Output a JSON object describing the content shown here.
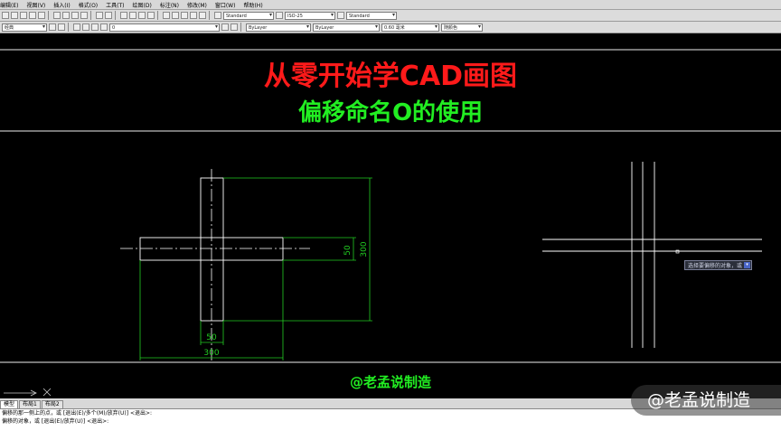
{
  "menubar": {
    "items": [
      "编辑(E)",
      "视图(V)",
      "插入(I)",
      "格式(O)",
      "工具(T)",
      "绘图(D)",
      "标注(N)",
      "修改(M)",
      "窗口(W)",
      "帮助(H)"
    ]
  },
  "toolbar": {
    "text_style": "Standard",
    "dim_style": "ISO-25",
    "table_style": "Standard",
    "workspace": "经典",
    "layer": "0",
    "color": "ByLayer",
    "linetype": "ByLayer",
    "lineweight": "0.60 毫米",
    "plot_style": "随颜色"
  },
  "overlay": {
    "title": "从零开始学CAD画图",
    "subtitle": "偏移命名O的使用",
    "watermark_center": "@老孟说制造",
    "watermark_corner": "@老孟说制造"
  },
  "drawing": {
    "dim_50_vertical": "50",
    "dim_300_vertical": "300",
    "dim_50_horizontal": "50",
    "dim_300_horizontal": "300",
    "tooltip": "选择要偏移的对象，或"
  },
  "tabs": [
    "模型",
    "布局1",
    "布局2"
  ],
  "command_line": {
    "line1": "偏移的那一侧上的点，或 [退出(E)/多个(M)/放弃(U)] <退出>:",
    "line2": "偏移的对象，或 [退出(E)/放弃(U)] <退出>:"
  },
  "colors": {
    "title": "#ff1a1a",
    "subtitle": "#22ee22",
    "dimension": "#22cc22",
    "geometry": "#ffffff"
  }
}
